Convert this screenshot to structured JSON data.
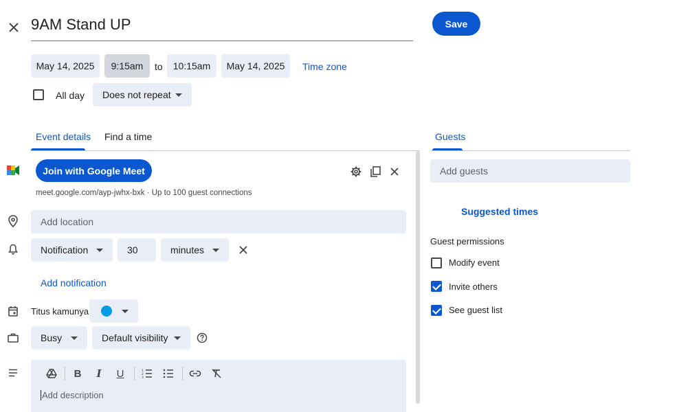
{
  "header": {
    "title": "9AM Stand UP",
    "save_label": "Save"
  },
  "datetime": {
    "start_date": "May 14, 2025",
    "start_time": "9:15am",
    "to_label": "to",
    "end_time": "10:15am",
    "end_date": "May 14, 2025",
    "timezone_label": "Time zone",
    "all_day_label": "All day",
    "repeat_value": "Does not repeat"
  },
  "tabs": {
    "event_details": "Event details",
    "find_a_time": "Find a time",
    "guests": "Guests"
  },
  "meet": {
    "join_label": "Join with Google Meet",
    "info": "meet.google.com/ayp-jwhx-bxk · Up to 100 guest connections"
  },
  "location": {
    "placeholder": "Add location"
  },
  "notification": {
    "type": "Notification",
    "amount": "30",
    "unit": "minutes",
    "add_label": "Add notification"
  },
  "calendar": {
    "owner": "Titus kamunya",
    "color": "#039be5"
  },
  "availability": {
    "status": "Busy",
    "visibility": "Default visibility"
  },
  "description": {
    "placeholder": "Add description"
  },
  "guests": {
    "placeholder": "Add guests",
    "suggested_times": "Suggested times",
    "permissions_title": "Guest permissions",
    "permissions": [
      {
        "label": "Modify event",
        "checked": false
      },
      {
        "label": "Invite others",
        "checked": true
      },
      {
        "label": "See guest list",
        "checked": true
      }
    ]
  },
  "colors": {
    "accent": "#0b57d0",
    "field_bg": "#e9eef6"
  }
}
